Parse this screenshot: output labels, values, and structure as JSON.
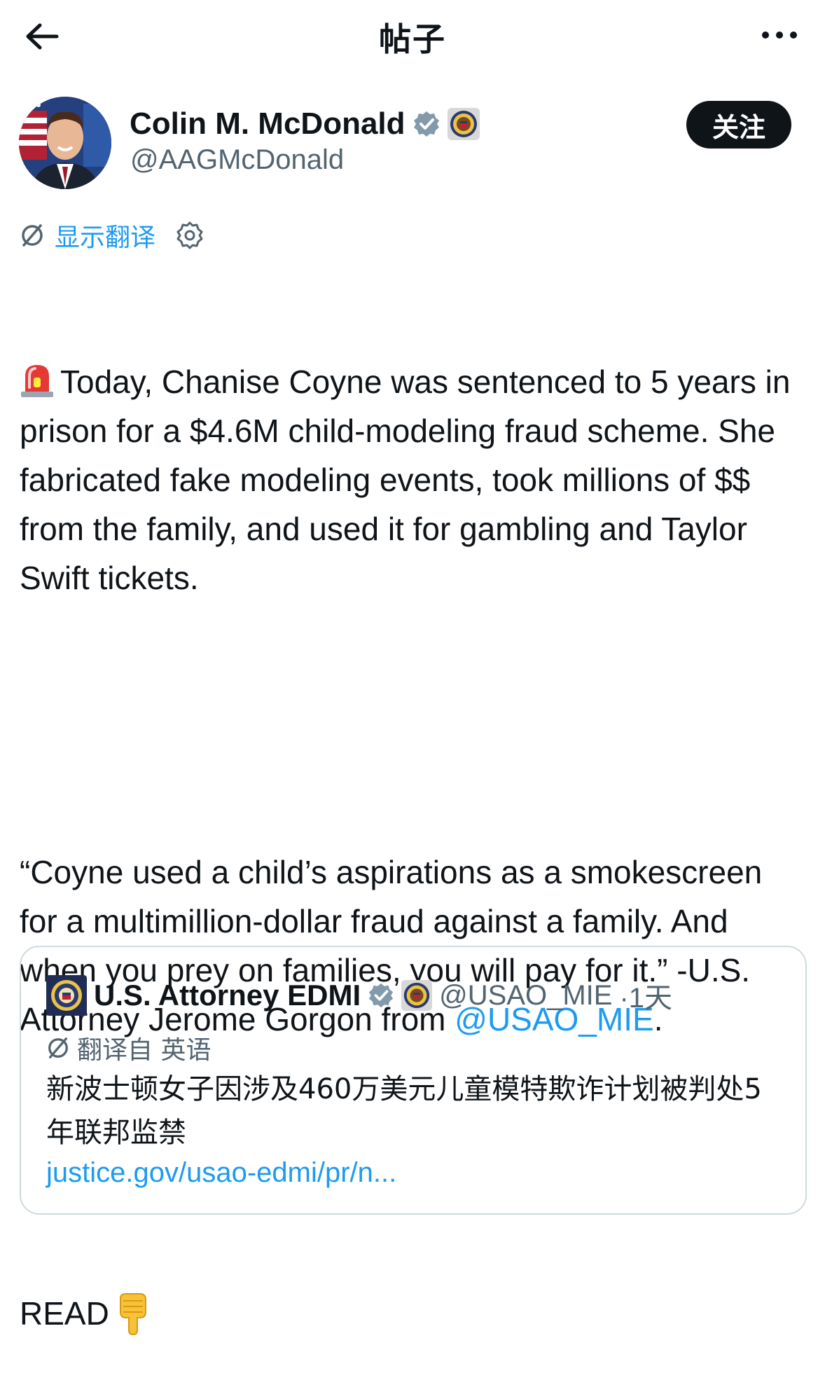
{
  "header": {
    "title": "帖子",
    "back_icon": "arrow-left-icon",
    "more_icon": "more-horizontal-icon"
  },
  "author": {
    "name": "Colin M. McDonald",
    "handle": "@AAGMcDonald",
    "verified_color": "#829aab",
    "follow_label": "关注"
  },
  "translate": {
    "label": "显示翻译",
    "settings_icon": "gear-icon"
  },
  "tweet": {
    "para1": "Today, Chanise Coyne was sentenced to 5 years in prison for a $4.6M child-modeling fraud scheme. She fabricated fake modeling events, took millions of $$ from the family, and used it for gambling and Taylor Swift tickets.",
    "para2_before": "“Coyne used a child’s aspirations as a smokescreen for a multimillion-dollar fraud against a family. And when you prey on families, you will pay for it.” -U.S. Attorney Jerome Gorgon from ",
    "para2_mention": "@USAO_MIE",
    "para2_after": ".",
    "para3": "READ"
  },
  "quote": {
    "name": "U.S. Attorney EDMI",
    "handle": "@USAO_MIE",
    "time": "·1天",
    "translated_label": "翻译自 英语",
    "text": "新波士顿女子因涉及460万美元儿童模特欺诈计划被判处5年联邦监禁",
    "link": "justice.gov/usao-edmi/pr/n..."
  },
  "colors": {
    "accent": "#1d9bf0",
    "text": "#0f1419",
    "secondary": "#536471",
    "border": "#cfd9de"
  }
}
